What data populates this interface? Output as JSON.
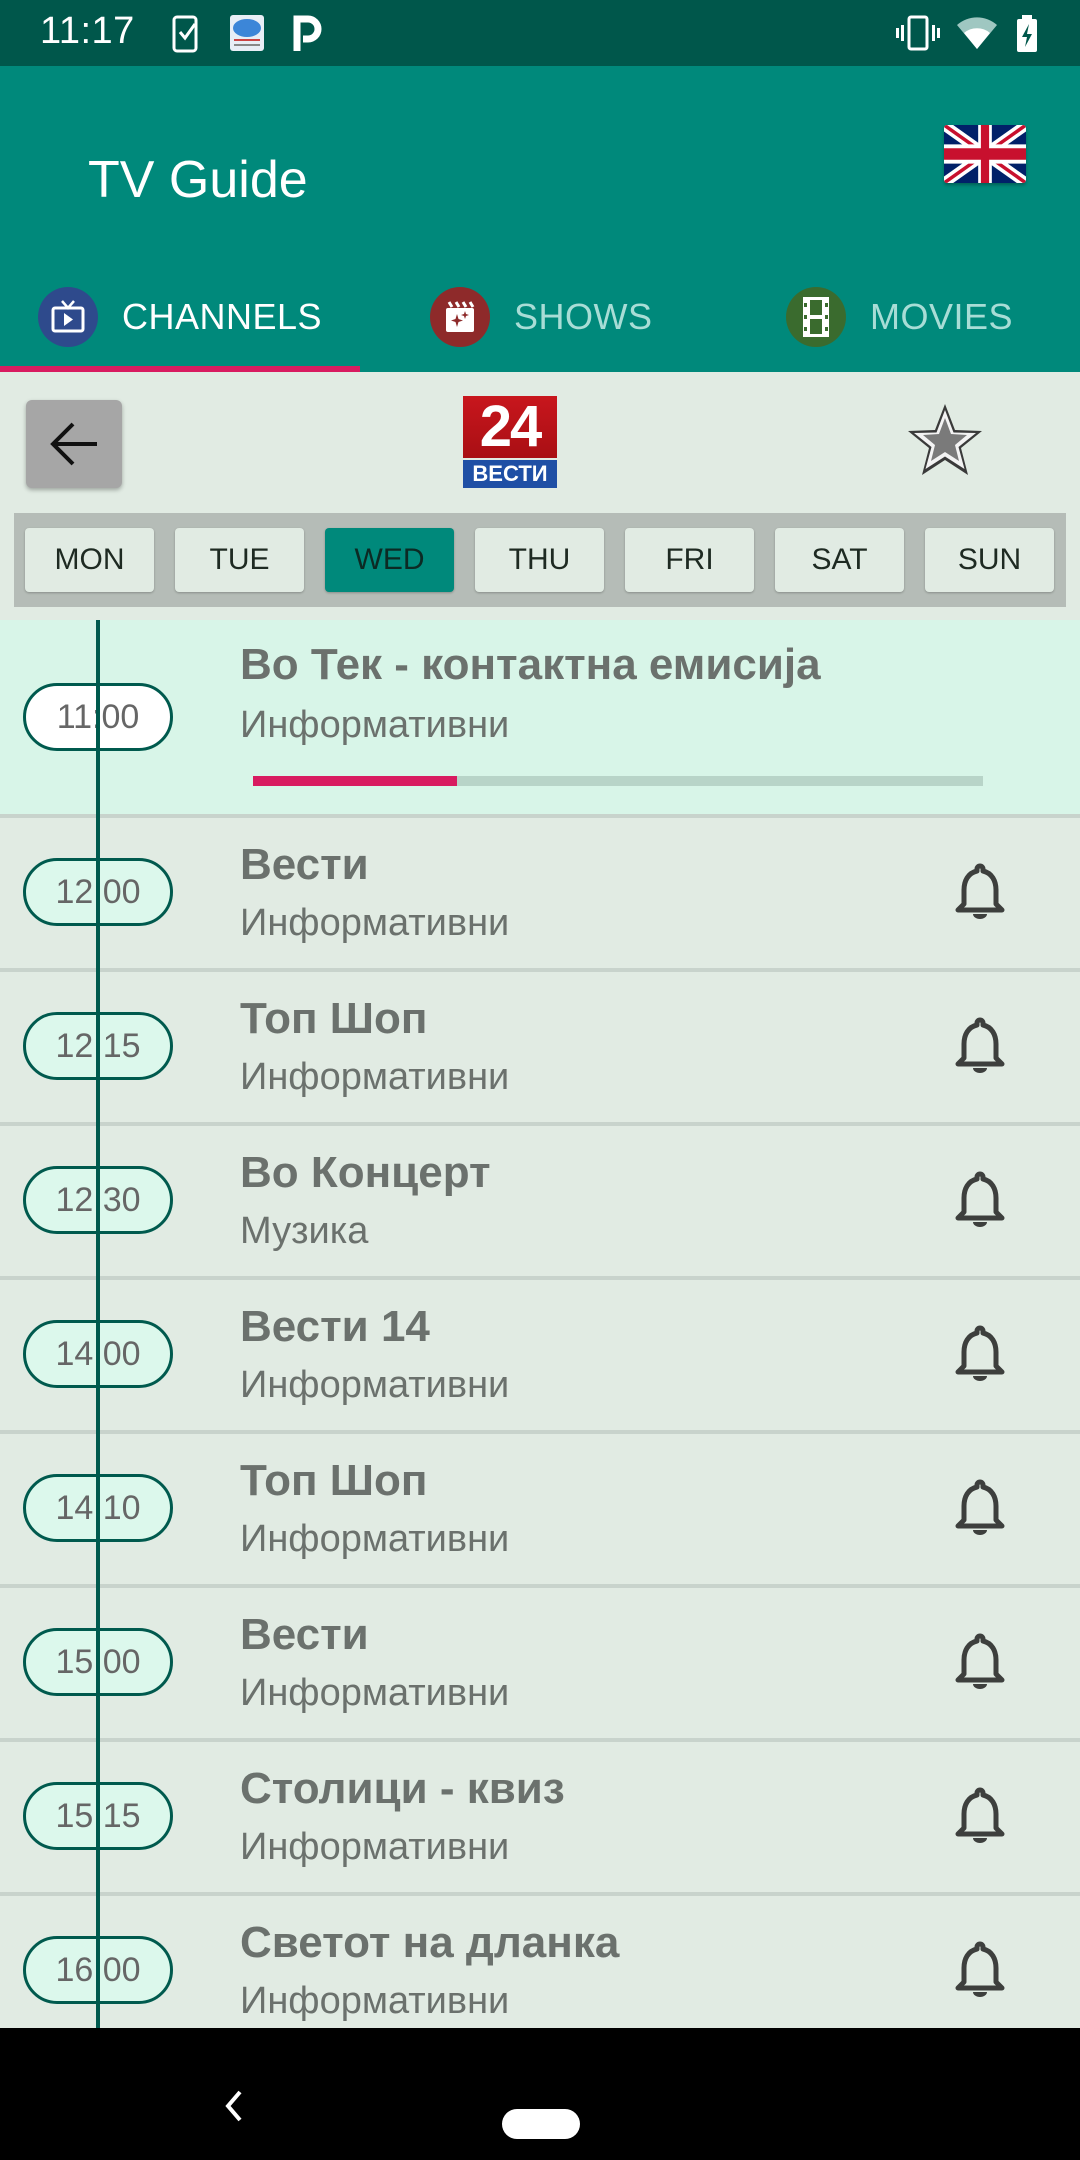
{
  "status_bar": {
    "time": "11:17",
    "left_icons": [
      "phone-check-icon",
      "test-cloud-app-icon",
      "parking-p-icon"
    ],
    "right_icons": [
      "vibrate-icon",
      "wifi-icon",
      "battery-charging-icon"
    ]
  },
  "app_bar": {
    "title": "TV Guide",
    "language_flag": "uk-flag-icon"
  },
  "tabs": [
    {
      "label": "CHANNELS",
      "icon": "tv-icon",
      "icon_color": "#2e4a8c",
      "active": true
    },
    {
      "label": "SHOWS",
      "icon": "clapperboard-icon",
      "icon_color": "#8e2a2a",
      "active": false
    },
    {
      "label": "MOVIES",
      "icon": "film-strip-icon",
      "icon_color": "#3a6b2e",
      "active": false
    }
  ],
  "channel_header": {
    "logo_top": "24",
    "logo_bottom": "ВЕСТИ",
    "favorite": false
  },
  "days": [
    {
      "label": "MON",
      "active": false
    },
    {
      "label": "TUE",
      "active": false
    },
    {
      "label": "WED",
      "active": true
    },
    {
      "label": "THU",
      "active": false
    },
    {
      "label": "FRI",
      "active": false
    },
    {
      "label": "SAT",
      "active": false
    },
    {
      "label": "SUN",
      "active": false
    }
  ],
  "programs": [
    {
      "time": "11:00",
      "title": "Во Тек - контактна емисија",
      "category": "Информативни",
      "current": true,
      "progress": 0.28
    },
    {
      "time": "12:00",
      "title": "Вести",
      "category": "Информативни"
    },
    {
      "time": "12:15",
      "title": "Топ Шоп",
      "category": "Информативни"
    },
    {
      "time": "12:30",
      "title": "Во Концерт",
      "category": "Музика"
    },
    {
      "time": "14:00",
      "title": "Вести 14",
      "category": "Информативни"
    },
    {
      "time": "14:10",
      "title": "Топ Шоп",
      "category": "Информативни"
    },
    {
      "time": "15:00",
      "title": "Вести",
      "category": "Информативни"
    },
    {
      "time": "15:15",
      "title": "Столици - квиз",
      "category": "Информативни"
    },
    {
      "time": "16:00",
      "title": "Светот на дланка",
      "category": "Информативни"
    }
  ],
  "colors": {
    "primary": "#00897b",
    "primary_dark": "#00574b",
    "accent": "#d81b60",
    "current_row": "#d8f5e8",
    "background": "#e1ebe3"
  }
}
